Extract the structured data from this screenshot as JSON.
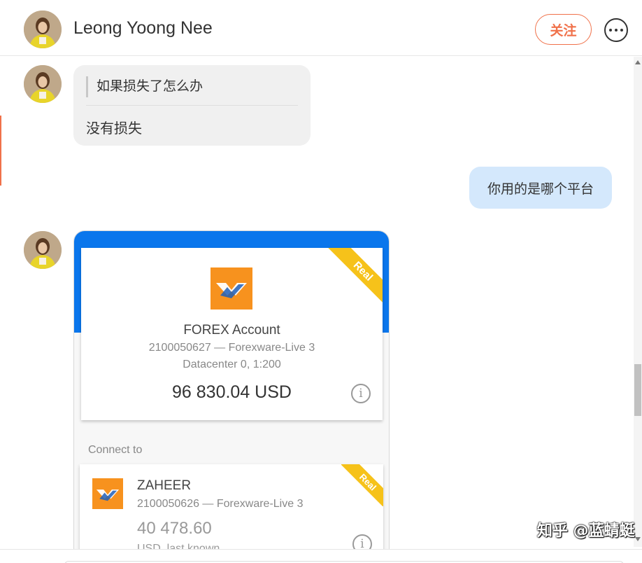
{
  "header": {
    "contact_name": "Leong Yoong Nee",
    "follow_label": "关注"
  },
  "messages": {
    "incoming_1": {
      "quote": "如果损失了怎么办",
      "text": "没有损失"
    },
    "outgoing_1": {
      "text": "你用的是哪个平台"
    }
  },
  "account_card": {
    "ribbon": "Real",
    "title": "FOREX Account",
    "account_line": "2100050627 — Forexware-Live 3",
    "datacenter_line": "Datacenter 0, 1:200",
    "balance": "96 830.04 USD",
    "connect_label": "Connect to",
    "connected": {
      "ribbon": "Real",
      "name": "ZAHEER",
      "account_line": "2100050626 — Forexware-Live 3",
      "balance": "40 478.60",
      "balance_note": "USD, last known"
    }
  },
  "watermark": "知乎 @蓝蜻蜓",
  "colors": {
    "follow_accent": "#f0714a",
    "outgoing_bubble": "#d4e8fc",
    "incoming_bubble": "#f0f0f0",
    "card_blue": "#0a76ec",
    "ribbon_gold": "#f6c21a",
    "logo_orange": "#f7921e"
  }
}
